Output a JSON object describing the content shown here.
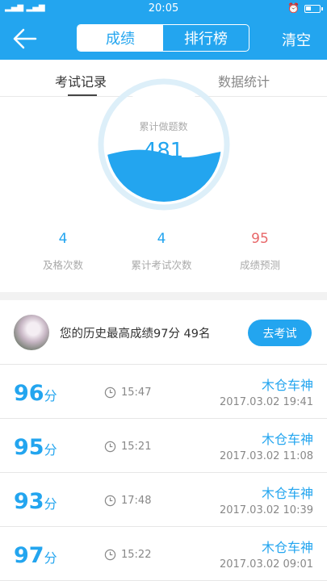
{
  "status_bar": {
    "signal": "▂▄▆ ▂▄▆",
    "time": "20:05"
  },
  "header": {
    "tabs": [
      {
        "label": "成绩",
        "active": true
      },
      {
        "label": "排行榜",
        "active": false
      }
    ],
    "clear_label": "清空"
  },
  "sub_tabs": [
    {
      "label": "考试记录",
      "active": true
    },
    {
      "label": "数据统计",
      "active": false
    }
  ],
  "summary": {
    "circle_label": "累计做题数",
    "total_questions": "481",
    "metrics": [
      {
        "value": "4",
        "label": "及格次数"
      },
      {
        "value": "4",
        "label": "累计考试次数"
      },
      {
        "value": "95",
        "label": "成绩预测"
      }
    ]
  },
  "best": {
    "text": "您的历史最高成绩97分  49名",
    "button_label": "去考试"
  },
  "records": [
    {
      "score": "96",
      "unit": "分",
      "duration": "15:47",
      "name": "木仓车神",
      "date": "2017.03.02  19:41"
    },
    {
      "score": "95",
      "unit": "分",
      "duration": "15:21",
      "name": "木仓车神",
      "date": "2017.03.02  11:08"
    },
    {
      "score": "93",
      "unit": "分",
      "duration": "17:48",
      "name": "木仓车神",
      "date": "2017.03.02  10:39"
    },
    {
      "score": "97",
      "unit": "分",
      "duration": "15:22",
      "name": "木仓车神",
      "date": "2017.03.02  09:01"
    }
  ],
  "colors": {
    "primary": "#23a5ef",
    "prediction": "#e8686a",
    "background": "#f2f2f2"
  },
  "icons": {
    "back": "arrow-left-icon",
    "clock": "clock-icon",
    "alarm": "alarm-icon",
    "battery": "battery-icon",
    "wifi": "wifi-icon"
  }
}
